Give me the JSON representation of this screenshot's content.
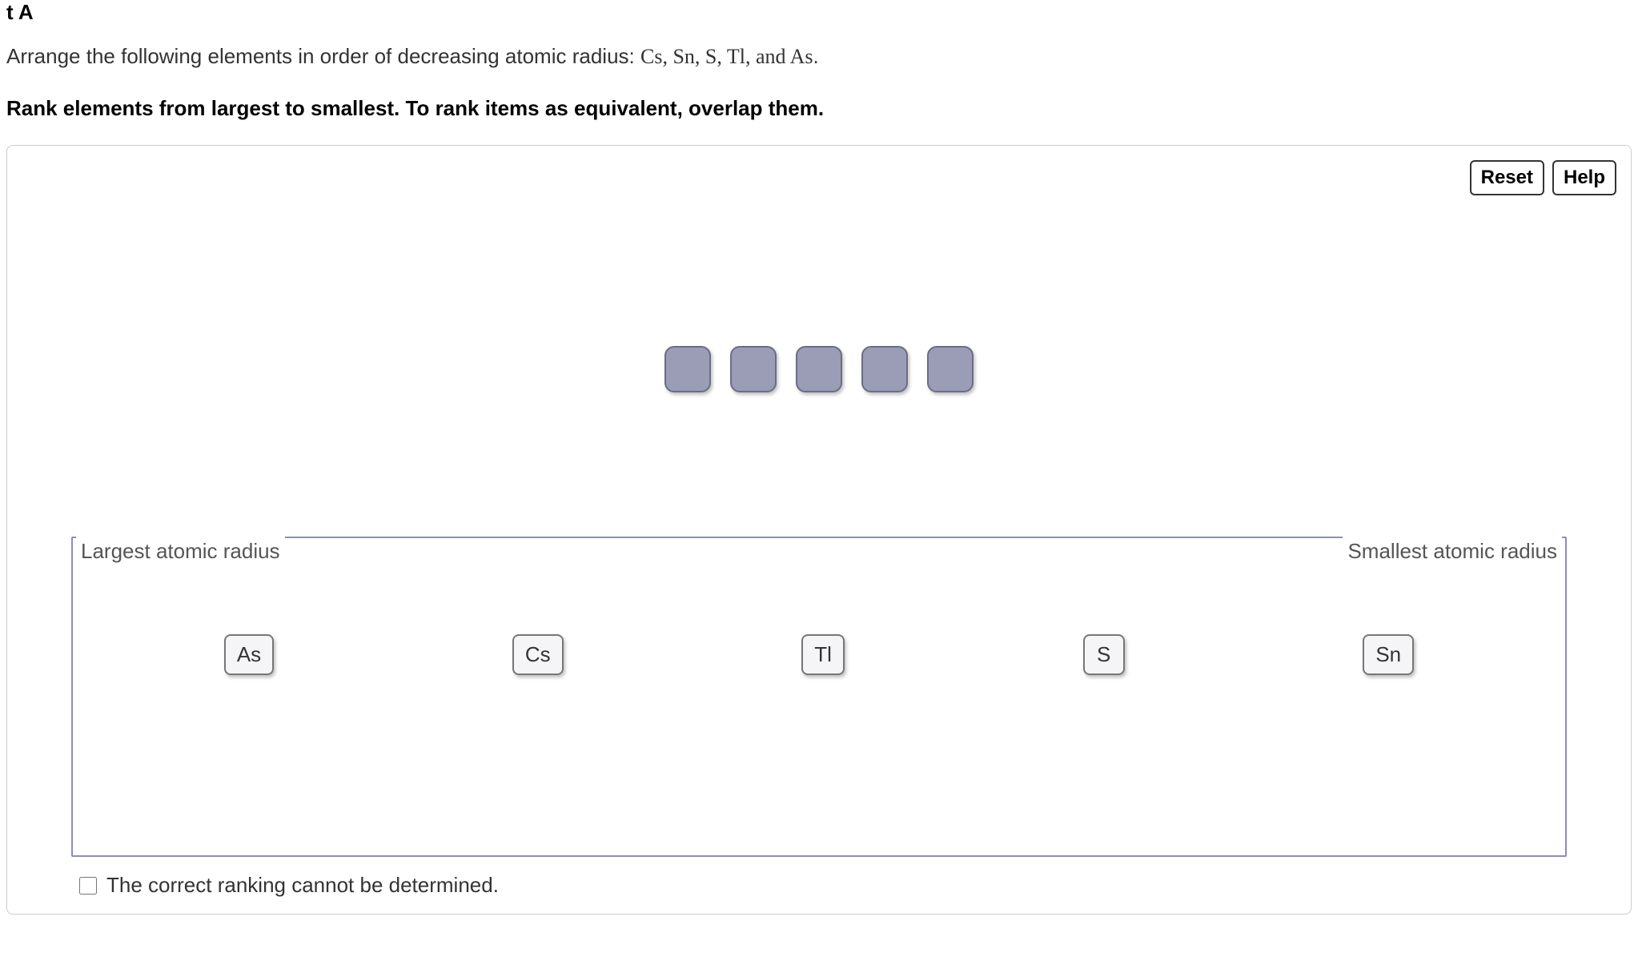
{
  "part_label": "t A",
  "question_prefix": "Arrange the following elements in order of decreasing atomic radius: ",
  "question_elements": "Cs, Sn, S, Tl, and As",
  "question_suffix": ".",
  "instruction": "Rank elements from largest to smallest. To rank items as equivalent, overlap them.",
  "buttons": {
    "reset": "Reset",
    "help": "Help"
  },
  "ranking": {
    "left_label": "Largest atomic radius",
    "right_label": "Smallest atomic radius"
  },
  "tiles": [
    "As",
    "Cs",
    "Tl",
    "S",
    "Sn"
  ],
  "checkbox_label": "The correct ranking cannot be determined."
}
